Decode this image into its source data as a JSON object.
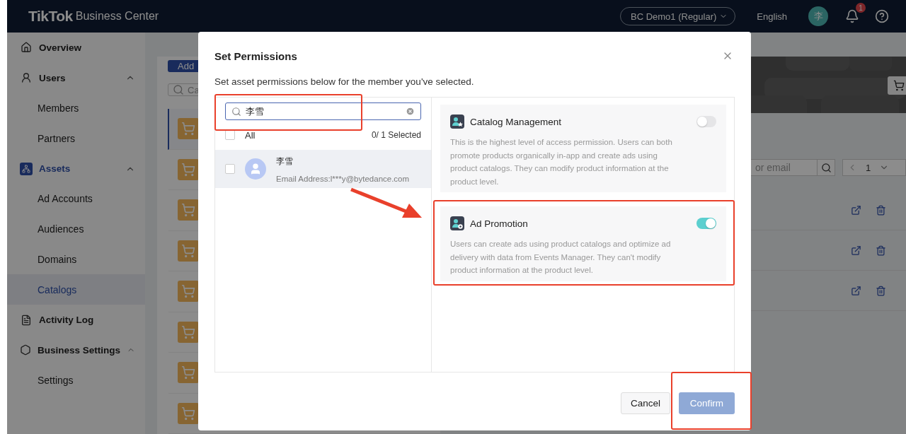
{
  "top_bar": {
    "logo": "TikTok",
    "logo_suffix": "Business Center",
    "account": "BC Demo1 (Regular)",
    "language": "English",
    "avatar": "李",
    "notifications": "1"
  },
  "sidebar": {
    "sections": [
      {
        "label": "Overview",
        "selected": false
      },
      {
        "label": "Users",
        "selected": false,
        "expanded": true,
        "children": [
          {
            "label": "Members",
            "selected": false
          },
          {
            "label": "Partners",
            "selected": false
          }
        ]
      },
      {
        "label": "Assets",
        "selected": true,
        "expanded": true,
        "children": [
          {
            "label": "Ad Accounts",
            "selected": false
          },
          {
            "label": "Audiences",
            "selected": false
          },
          {
            "label": "Domains",
            "selected": false
          },
          {
            "label": "Catalogs",
            "selected": true
          }
        ]
      },
      {
        "label": "Activity Log",
        "selected": false
      },
      {
        "label": "Business Settings",
        "selected": false,
        "expanded": true,
        "children": [
          {
            "label": "Settings",
            "selected": false
          }
        ]
      }
    ]
  },
  "catalog_page": {
    "add_button": "Add",
    "search_placeholder": "Ca",
    "email_placeholder": "or email",
    "page": "1",
    "rows": [
      {
        "selected": true
      },
      {
        "selected": false
      },
      {
        "selected": false
      },
      {
        "selected": false
      },
      {
        "selected": false
      },
      {
        "selected": false
      },
      {
        "selected": false
      },
      {
        "selected": false
      }
    ]
  },
  "modal": {
    "title": "Set Permissions",
    "subtitle": "Set asset permissions below for the member you've selected.",
    "search": {
      "value": "李雪"
    },
    "all": {
      "label": "All",
      "checked": false
    },
    "selected_count": "0/ 1 Selected",
    "members": [
      {
        "name": "李雪",
        "email": "Email Address:l***y@bytedance.com",
        "checked": false,
        "selected": true
      }
    ],
    "permissions": [
      {
        "title": "Catalog Management",
        "description": "This is the highest level of access permission. Users can both promote products organically in-app and create ads using product catalogs. They can modify product information at the product level.",
        "on": false
      },
      {
        "title": "Ad Promotion",
        "description": "Users can create ads using product catalogs and optimize ad delivery with data from Events Manager. They can't modify product information at the product level.",
        "on": true
      }
    ],
    "cancel": "Cancel",
    "confirm": {
      "label": "Confirm",
      "disabled": true
    }
  },
  "annotations": [
    {
      "kind": "frame"
    },
    {
      "kind": "arrow"
    },
    {
      "kind": "frame"
    },
    {
      "kind": "frame"
    }
  ]
}
